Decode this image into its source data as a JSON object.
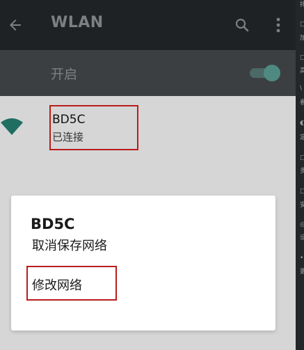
{
  "appbar": {
    "title": "WLAN",
    "back_icon": "arrow-left-icon",
    "search_icon": "search-icon",
    "more_icon": "more-vert-icon"
  },
  "wlan_switch": {
    "label": "开启",
    "state": "on"
  },
  "network": {
    "name": "BD5C",
    "status": "已连接",
    "icon": "wifi-signal-icon"
  },
  "dialog": {
    "title": "BD5C",
    "items": [
      {
        "label": "取消保存网络"
      },
      {
        "label": "修改网络"
      }
    ]
  },
  "side_panel": {
    "glyphs": [
      "排",
      "□",
      "加",
      "□",
      "高",
      "\\",
      "看",
      "◐",
      "定",
      "□",
      "多",
      "□",
      "安",
      "◎",
      "设",
      "•",
      "更"
    ]
  },
  "colors": {
    "appbar_bg": "#1f2224",
    "switch_bar_bg": "#3c3f41",
    "scrim_bg": "#d6d6d6",
    "accent_teal": "#1f6e62",
    "highlight_red": "#b81c1c"
  }
}
